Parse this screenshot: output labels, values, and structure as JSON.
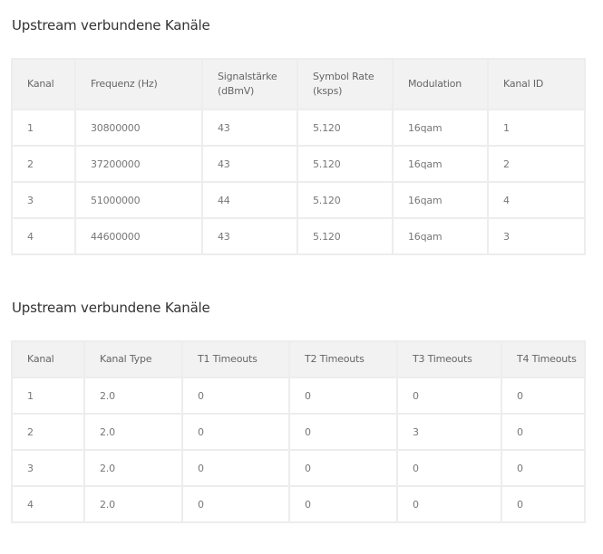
{
  "upstream_table": {
    "title": "Upstream verbundene Kanäle",
    "headers": [
      {
        "line1": "Kanal",
        "line2": ""
      },
      {
        "line1": "Frequenz (Hz)",
        "line2": ""
      },
      {
        "line1": "Signalstärke",
        "line2": "(dBmV)"
      },
      {
        "line1": "Symbol Rate",
        "line2": "(ksps)"
      },
      {
        "line1": "Modulation",
        "line2": ""
      },
      {
        "line1": "Kanal ID",
        "line2": ""
      }
    ],
    "rows": [
      [
        "1",
        "30800000",
        "43",
        "5.120",
        "16qam",
        "1"
      ],
      [
        "2",
        "37200000",
        "43",
        "5.120",
        "16qam",
        "2"
      ],
      [
        "3",
        "51000000",
        "44",
        "5.120",
        "16qam",
        "4"
      ],
      [
        "4",
        "44600000",
        "43",
        "5.120",
        "16qam",
        "3"
      ]
    ]
  },
  "timeouts_table": {
    "title": "Upstream verbundene Kanäle",
    "headers": [
      "Kanal",
      "Kanal Type",
      "T1 Timeouts",
      "T2 Timeouts",
      "T3 Timeouts",
      "T4 Timeouts"
    ],
    "rows": [
      [
        "1",
        "2.0",
        "0",
        "0",
        "0",
        "0"
      ],
      [
        "2",
        "2.0",
        "0",
        "0",
        "3",
        "0"
      ],
      [
        "3",
        "2.0",
        "0",
        "0",
        "0",
        "0"
      ],
      [
        "4",
        "2.0",
        "0",
        "0",
        "0",
        "0"
      ]
    ]
  },
  "colors": {
    "header_bg": "#f2f2f2",
    "border": "#ededed",
    "title_text": "#333333",
    "cell_text": "#777777"
  }
}
